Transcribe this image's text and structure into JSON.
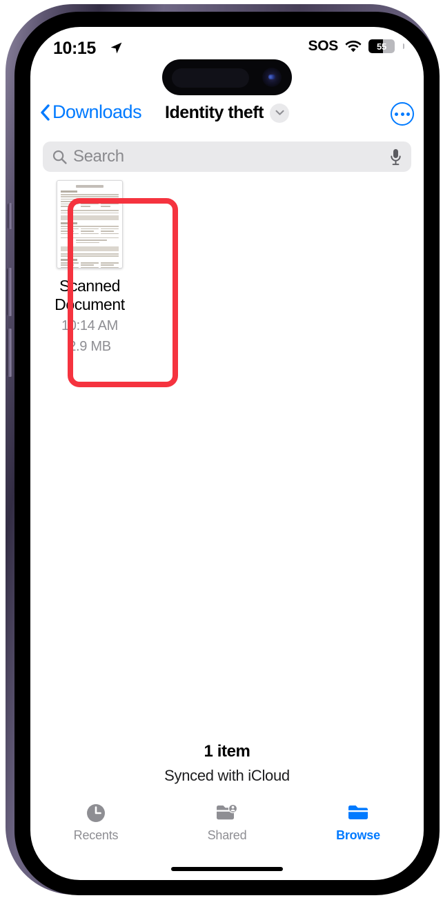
{
  "device": {
    "name": "iphone-15-pro"
  },
  "status_bar": {
    "time": "10:15",
    "location_icon": "location-arrow-icon",
    "sos_label": "SOS",
    "wifi_icon": "wifi-icon",
    "battery_percent": "55",
    "battery_level": 55
  },
  "nav_bar": {
    "back_label": "Downloads",
    "back_icon": "chevron-left-icon",
    "title": "Identity theft",
    "title_chevron_icon": "chevron-down-icon",
    "more_icon": "ellipsis-circle-icon"
  },
  "search": {
    "placeholder": "Search",
    "search_icon": "magnifier-icon",
    "mic_icon": "microphone-icon",
    "value": ""
  },
  "files": [
    {
      "name": "Scanned Document",
      "time": "10:14 AM",
      "size": "2.9 MB",
      "thumbnail": "scanned-document-thumbnail",
      "highlighted": true
    }
  ],
  "footer": {
    "item_count": "1 item",
    "sync_status": "Synced with iCloud"
  },
  "tab_bar": {
    "tabs": [
      {
        "label": "Recents",
        "icon": "clock-icon",
        "active": false
      },
      {
        "label": "Shared",
        "icon": "shared-folder-icon",
        "active": false
      },
      {
        "label": "Browse",
        "icon": "folder-icon",
        "active": true
      }
    ]
  },
  "colors": {
    "accent": "#007aff",
    "annotation": "#f5333f",
    "secondary_text": "#8e8e93",
    "search_background": "#e9e9eb"
  }
}
